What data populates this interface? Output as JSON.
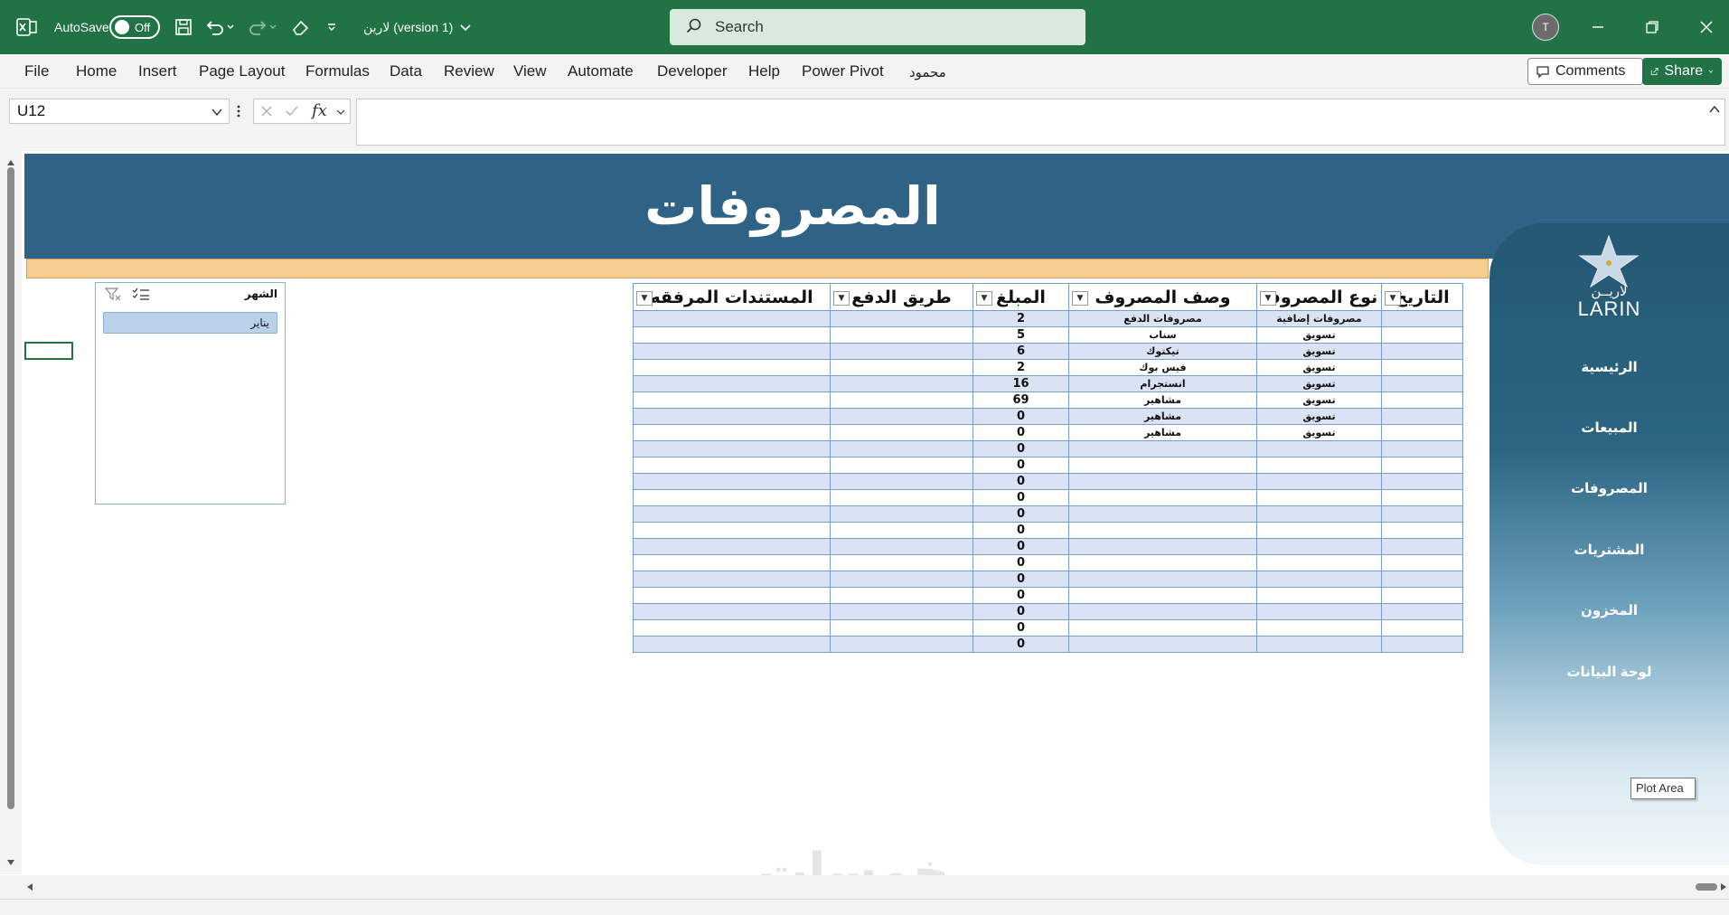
{
  "titlebar": {
    "autosave_label": "AutoSave",
    "autosave_state": "Off",
    "filename": "لارين (version 1)",
    "search_placeholder": "Search",
    "avatar_initial": "T"
  },
  "menu": {
    "items": [
      "File",
      "Home",
      "Insert",
      "Page Layout",
      "Formulas",
      "Data",
      "Review",
      "View",
      "Automate",
      "Developer",
      "Help",
      "Power Pivot",
      "محمود"
    ],
    "comments_label": "Comments",
    "share_label": "Share"
  },
  "formula_bar": {
    "name_box": "U12",
    "fx_label": "fx",
    "formula": ""
  },
  "sheet": {
    "banner_title": "المصروفات",
    "slicer": {
      "header": "الشهر",
      "item": "يناير"
    },
    "table": {
      "headers": [
        "التاريخ",
        "نوع المصروف",
        "وصف المصروف",
        "المبلغ",
        "طريق الدفع",
        "المستندات المرفقه"
      ],
      "rows": [
        [
          "",
          "مصروفات إضافية",
          "مصروفات الدفع",
          "2",
          "",
          ""
        ],
        [
          "",
          "تسويق",
          "سناب",
          "5",
          "",
          ""
        ],
        [
          "",
          "تسويق",
          "تيكتوك",
          "6",
          "",
          ""
        ],
        [
          "",
          "تسويق",
          "فيس بوك",
          "2",
          "",
          ""
        ],
        [
          "",
          "تسويق",
          "انستجرام",
          "16",
          "",
          ""
        ],
        [
          "",
          "تسويق",
          "مشاهير",
          "69",
          "",
          ""
        ],
        [
          "",
          "تسويق",
          "مشاهير",
          "0",
          "",
          ""
        ],
        [
          "",
          "تسويق",
          "مشاهير",
          "0",
          "",
          ""
        ],
        [
          "",
          "",
          "",
          "0",
          "",
          ""
        ],
        [
          "",
          "",
          "",
          "0",
          "",
          ""
        ],
        [
          "",
          "",
          "",
          "0",
          "",
          ""
        ],
        [
          "",
          "",
          "",
          "0",
          "",
          ""
        ],
        [
          "",
          "",
          "",
          "0",
          "",
          ""
        ],
        [
          "",
          "",
          "",
          "0",
          "",
          ""
        ],
        [
          "",
          "",
          "",
          "0",
          "",
          ""
        ],
        [
          "",
          "",
          "",
          "0",
          "",
          ""
        ],
        [
          "",
          "",
          "",
          "0",
          "",
          ""
        ],
        [
          "",
          "",
          "",
          "0",
          "",
          ""
        ],
        [
          "",
          "",
          "",
          "0",
          "",
          ""
        ],
        [
          "",
          "",
          "",
          "0",
          "",
          ""
        ],
        [
          "",
          "",
          "",
          "0",
          "",
          ""
        ]
      ]
    },
    "sidebar": {
      "logo_text": "LARIN",
      "logo_arabic": "لاريــن",
      "nav": [
        "الرئيسية",
        "المبيعات",
        "المصروفات",
        "المشتريات",
        "المخزون",
        "لوحة البيانات"
      ]
    },
    "plot_area_tooltip": "Plot Area",
    "watermark": "خمسات"
  },
  "colors": {
    "excel_green": "#217346",
    "banner": "#2e6386",
    "yellow_bar": "#f6cd8e",
    "row_band": "#dae3f3"
  }
}
